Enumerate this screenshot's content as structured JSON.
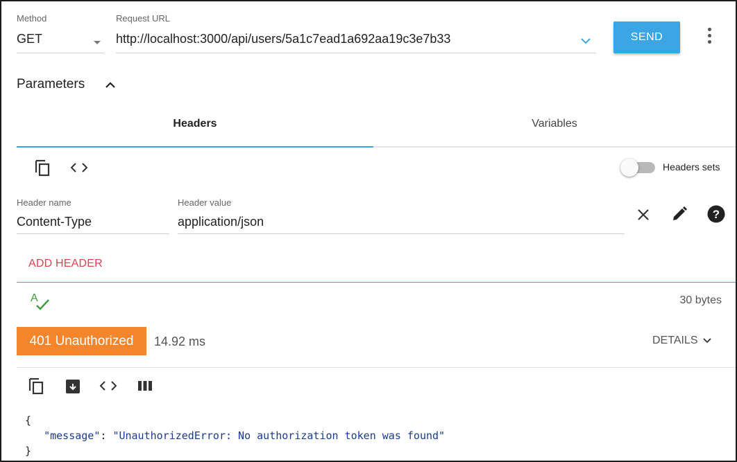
{
  "request": {
    "method_label": "Method",
    "method_value": "GET",
    "url_label": "Request URL",
    "url_value": "http://localhost:3000/api/users/5a1c7ead1a692aa19c3e7b33",
    "send_label": "SEND"
  },
  "parameters": {
    "title": "Parameters",
    "tabs": [
      {
        "label": "Headers",
        "active": true
      },
      {
        "label": "Variables",
        "active": false
      }
    ],
    "headers_sets_label": "Headers sets",
    "headers_sets_enabled": false,
    "header_name_label": "Header name",
    "header_name_value": "Content-Type",
    "header_value_label": "Header value",
    "header_value_value": "application/json",
    "add_header_label": "ADD HEADER"
  },
  "response": {
    "size": "30 bytes",
    "status": "401 Unauthorized",
    "time": "14.92 ms",
    "details_label": "DETAILS",
    "body_open": "{",
    "body_key": "\"message\"",
    "body_colon": ": ",
    "body_value": "\"UnauthorizedError: No authorization token was found\"",
    "body_close": "}"
  },
  "colors": {
    "accent": "#3aa6e6",
    "status_error": "#f5852a",
    "add_header": "#e0404f",
    "spellcheck": "#3a9d3a"
  },
  "icons": [
    "chevron-down-icon",
    "more-vert-icon",
    "chevron-up-icon",
    "copy-icon",
    "code-icon",
    "close-icon",
    "edit-icon",
    "help-icon",
    "spellcheck-icon",
    "save-icon",
    "columns-icon"
  ]
}
